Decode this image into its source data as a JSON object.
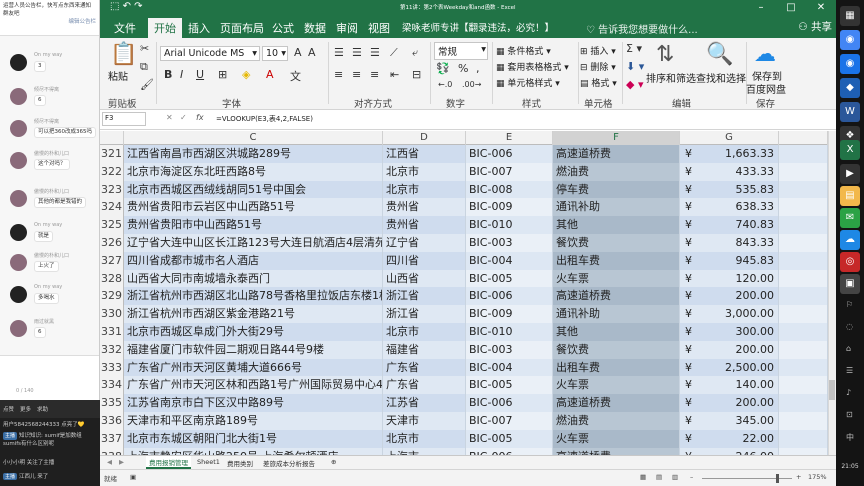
{
  "chat": {
    "top_text": "运营人员公告栏，快写点东西来通知群友吧",
    "edit_hint": "编辑公告栏",
    "messages": [
      {
        "name": "On my way",
        "text": "3",
        "avatar": "dark"
      },
      {
        "name": "倾尽不得离",
        "text": "6",
        "avatar": "photo"
      },
      {
        "name": "倾尽不得离",
        "text": "可以把360改成365吗",
        "avatar": "photo"
      },
      {
        "name": "傲慢的朴和儿口",
        "text": "这个对吗？",
        "avatar": "photo"
      },
      {
        "name": "傲慢的朴和儿口",
        "text": "其他的都是我错的",
        "avatar": "photo"
      },
      {
        "name": "On my way",
        "text": "就是",
        "avatar": "dark"
      },
      {
        "name": "傲慢的朴和儿口",
        "text": "上火了",
        "avatar": "photo"
      },
      {
        "name": "On my way",
        "text": "多喝水",
        "avatar": "dark"
      },
      {
        "name": "雨过就黑",
        "text": "6",
        "avatar": "photo"
      }
    ],
    "counter": "0 / 140"
  },
  "live": {
    "tabs": [
      "点赞",
      "更多",
      "求助"
    ],
    "lines": [
      {
        "tag": "",
        "text": "用户5842568244333 点亮了",
        "highlight": "💛"
      },
      {
        "tag": "主播",
        "text": "知识知识: sumif是加数组sumifs有什么区别呢"
      },
      {
        "tag": "",
        "text": "小小小明 关注了主播",
        "highlight": ""
      },
      {
        "tag": "主播",
        "text": "江西儿 来了"
      }
    ]
  },
  "excel": {
    "window_title": "第11讲：第2个表Weekday和and函数 - Excel",
    "tabs": [
      "文件",
      "开始",
      "插入",
      "页面布局",
      "公式",
      "数据",
      "审阅",
      "视图",
      "梁咏老师专讲【翻录违法，必究！】"
    ],
    "active_tab": "开始",
    "tell_me": "♡ 告诉我您想要做什么...",
    "share": "共享",
    "ribbon": {
      "paste": "粘贴",
      "font_name": "Arial Unicode MS",
      "font_size": "10",
      "number_format": "常规",
      "conditional_format": "条件格式",
      "table_format": "套用表格格式",
      "cell_style": "单元格样式",
      "insert": "插入",
      "delete": "删除",
      "format": "格式",
      "sort_filter": "排序和筛选",
      "find_select": "查找和选择",
      "save_to_cloud": "保存到",
      "cloud_name": "百度网盘",
      "groups": [
        "剪贴板",
        "字体",
        "对齐方式",
        "数字",
        "样式",
        "单元格",
        "编辑",
        "保存"
      ]
    },
    "name_box": "F3",
    "formula": "=VLOOKUP(E3,表4,2,FALSE)",
    "columns": [
      "C",
      "D",
      "E",
      "F",
      "G"
    ],
    "rows": [
      {
        "n": "321",
        "addr": "江西省南昌市西湖区洪城路289号",
        "prov": "江西省",
        "code": "BIC-006",
        "type": "高速道桥费",
        "cur": "¥",
        "amt": "1,663.33"
      },
      {
        "n": "322",
        "addr": "北京市海淀区东北旺西路8号",
        "prov": "北京市",
        "code": "BIC-007",
        "type": "燃油费",
        "cur": "¥",
        "amt": "433.33"
      },
      {
        "n": "323",
        "addr": "北京市西城区西绒线胡同51号中国会",
        "prov": "北京市",
        "code": "BIC-008",
        "type": "停车费",
        "cur": "¥",
        "amt": "535.83"
      },
      {
        "n": "324",
        "addr": "贵州省贵阳市云岩区中山西路51号",
        "prov": "贵州省",
        "code": "BIC-009",
        "type": "通讯补助",
        "cur": "¥",
        "amt": "638.33"
      },
      {
        "n": "325",
        "addr": "贵州省贵阳市中山西路51号",
        "prov": "贵州省",
        "code": "BIC-010",
        "type": "其他",
        "cur": "¥",
        "amt": "740.83"
      },
      {
        "n": "326",
        "addr": "辽宁省大连中山区长江路123号大连日航酒店4层清苑厅",
        "prov": "辽宁省",
        "code": "BIC-003",
        "type": "餐饮费",
        "cur": "¥",
        "amt": "843.33"
      },
      {
        "n": "327",
        "addr": "四川省成都市城市名人酒店",
        "prov": "四川省",
        "code": "BIC-004",
        "type": "出租车费",
        "cur": "¥",
        "amt": "945.83"
      },
      {
        "n": "328",
        "addr": "山西省大同市南城墙永泰西门",
        "prov": "山西省",
        "code": "BIC-005",
        "type": "火车票",
        "cur": "¥",
        "amt": "120.00"
      },
      {
        "n": "329",
        "addr": "浙江省杭州市西湖区北山路78号香格里拉饭店东楼1栋555房",
        "prov": "浙江省",
        "code": "BIC-006",
        "type": "高速道桥费",
        "cur": "¥",
        "amt": "200.00"
      },
      {
        "n": "330",
        "addr": "浙江省杭州市西湖区紫金港路21号",
        "prov": "浙江省",
        "code": "BIC-009",
        "type": "通讯补助",
        "cur": "¥",
        "amt": "3,000.00"
      },
      {
        "n": "331",
        "addr": "北京市西城区阜成门外大街29号",
        "prov": "北京市",
        "code": "BIC-010",
        "type": "其他",
        "cur": "¥",
        "amt": "300.00"
      },
      {
        "n": "332",
        "addr": "福建省厦门市软件园二期观日路44号9楼",
        "prov": "福建省",
        "code": "BIC-003",
        "type": "餐饮费",
        "cur": "¥",
        "amt": "200.00"
      },
      {
        "n": "333",
        "addr": "广东省广州市天河区黄埔大道666号",
        "prov": "广东省",
        "code": "BIC-004",
        "type": "出租车费",
        "cur": "¥",
        "amt": "2,500.00"
      },
      {
        "n": "334",
        "addr": "广东省广州市天河区林和西路1号广州国际贸易中心42层",
        "prov": "广东省",
        "code": "BIC-005",
        "type": "火车票",
        "cur": "¥",
        "amt": "140.00"
      },
      {
        "n": "335",
        "addr": "江苏省南京市白下区汉中路89号",
        "prov": "江苏省",
        "code": "BIC-006",
        "type": "高速道桥费",
        "cur": "¥",
        "amt": "200.00"
      },
      {
        "n": "336",
        "addr": "天津市和平区南京路189号",
        "prov": "天津市",
        "code": "BIC-007",
        "type": "燃油费",
        "cur": "¥",
        "amt": "345.00"
      },
      {
        "n": "337",
        "addr": "北京市东城区朝阳门北大街1号",
        "prov": "北京市",
        "code": "BIC-005",
        "type": "火车票",
        "cur": "¥",
        "amt": "22.00"
      },
      {
        "n": "338",
        "addr": "上海市静安区华山路250号 上海希尔顿酒店",
        "prov": "上海市",
        "code": "BIC-006",
        "type": "高速道桥费",
        "cur": "¥",
        "amt": "246.00"
      }
    ],
    "sheets": [
      "费用报销管理",
      "Sheet1",
      "费用类别",
      "差旅成本分析报告"
    ],
    "active_sheet": "费用报销管理",
    "status_left": "就绪",
    "zoom": "175%"
  },
  "taskbar": {
    "time": "21:05"
  },
  "colors": {
    "excel_green": "#217346",
    "selection_blue": "#cfdcee",
    "col_f": "#a9b9c9"
  }
}
